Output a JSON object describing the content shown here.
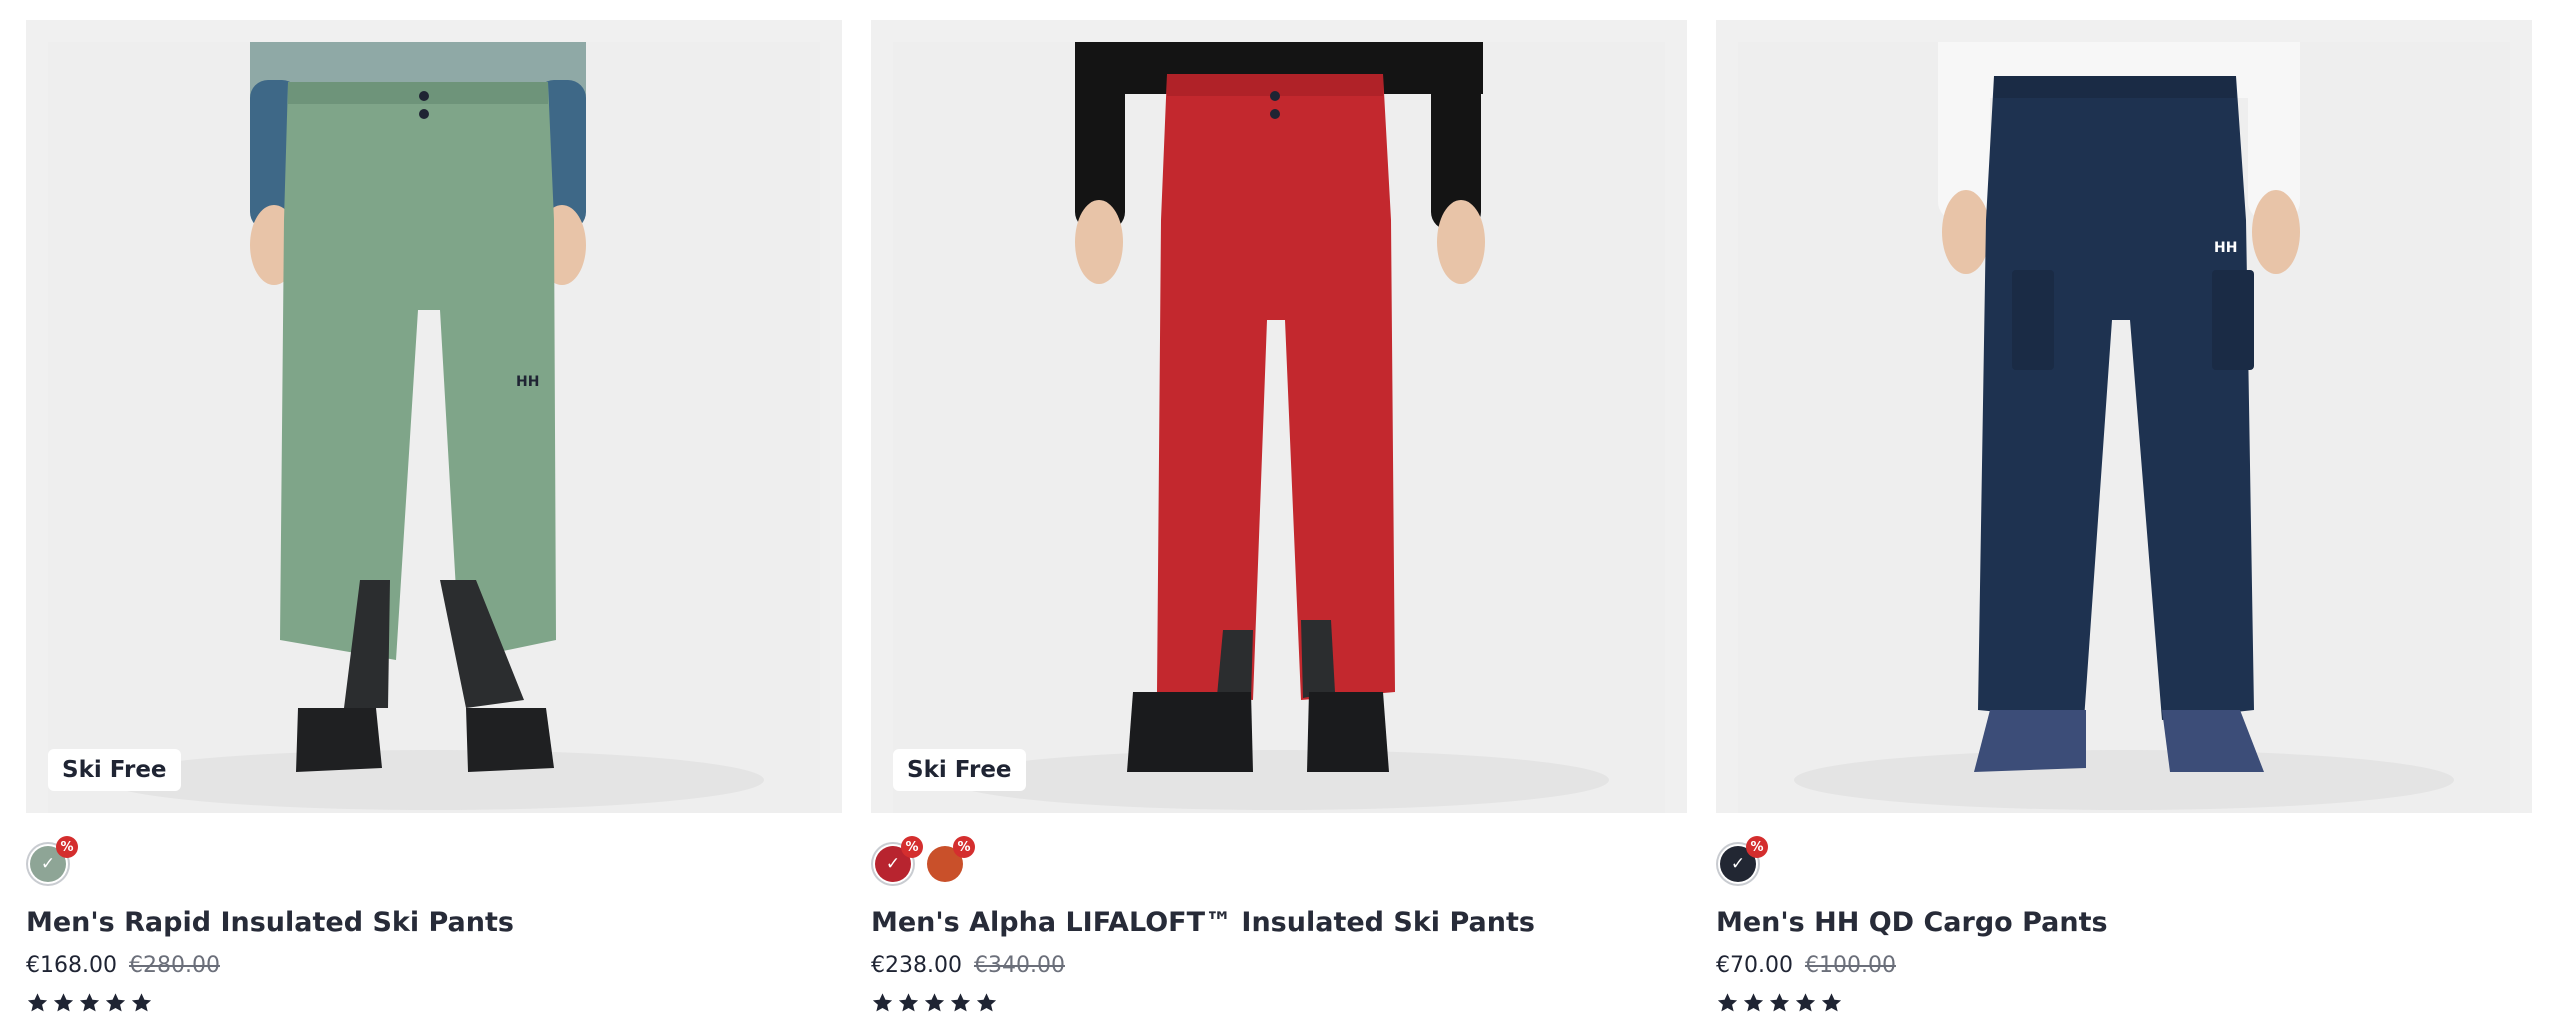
{
  "colors": {
    "sale_badge": "#d42e2e",
    "text": "#1f2433",
    "muted": "#6b6f7a",
    "media_bg": "#f0f0f0"
  },
  "products": [
    {
      "badge": "Ski Free",
      "title": "Men's Rapid Insulated Ski Pants",
      "price_now": "€168.00",
      "price_was": "€280.00",
      "rating": 5,
      "swatches": [
        {
          "color": "#8ea596",
          "selected": true,
          "sale_mark": "%"
        }
      ],
      "image_desc": "green-ski-pants"
    },
    {
      "badge": "Ski Free",
      "title": "Men's Alpha LIFALOFT™ Insulated Ski Pants",
      "price_now": "€238.00",
      "price_was": "€340.00",
      "rating": 5,
      "swatches": [
        {
          "color": "#b8242f",
          "selected": true,
          "sale_mark": "%"
        },
        {
          "color": "#c9502a",
          "selected": false,
          "sale_mark": "%"
        }
      ],
      "image_desc": "red-ski-pants"
    },
    {
      "badge": "",
      "title": "Men's HH QD Cargo Pants",
      "price_now": "€70.00",
      "price_was": "€100.00",
      "rating": 5,
      "swatches": [
        {
          "color": "#222733",
          "selected": true,
          "sale_mark": "%"
        }
      ],
      "image_desc": "navy-cargo-pants"
    }
  ]
}
